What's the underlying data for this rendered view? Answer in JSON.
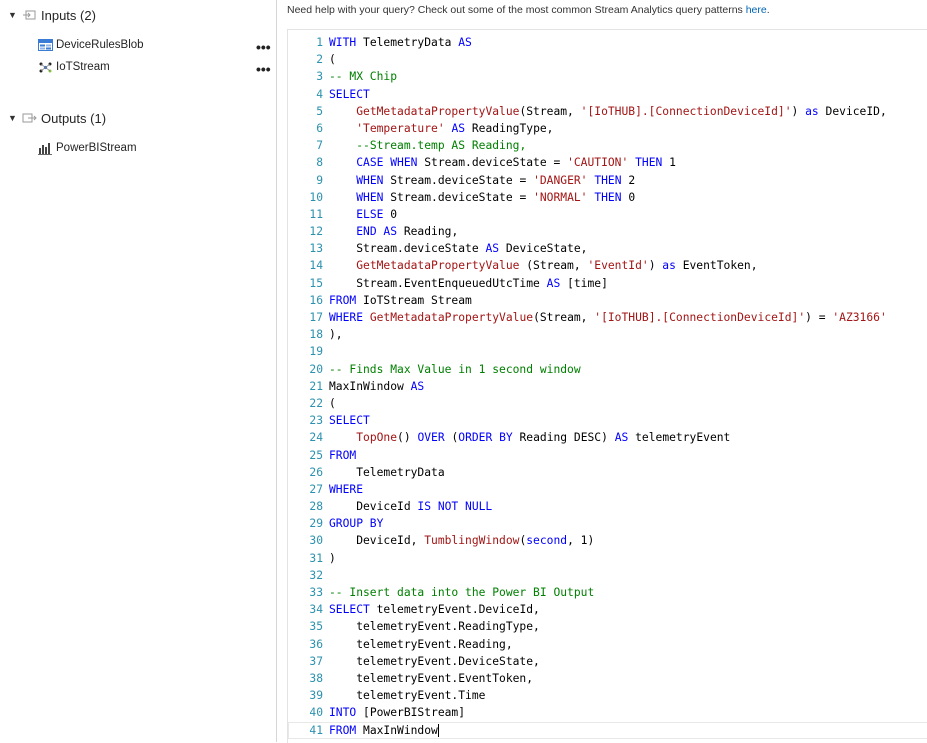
{
  "sidebar": {
    "inputs_label": "Inputs (2)",
    "inputs_items": [
      {
        "label": "DeviceRulesBlob",
        "icon": "blob-storage-icon"
      },
      {
        "label": "IoTStream",
        "icon": "iot-hub-icon"
      }
    ],
    "outputs_label": "Outputs (1)",
    "outputs_items": [
      {
        "label": "PowerBIStream",
        "icon": "power-bi-icon"
      }
    ],
    "more_label": "•••"
  },
  "help": {
    "text": "Need help with your query? Check out some of the most common Stream Analytics query patterns ",
    "link": "here",
    "suffix": "."
  },
  "colors": {
    "keyword": "#0000ff",
    "string": "#a31515",
    "comment": "#008000",
    "line_number": "#2b91af",
    "link": "#0064b4"
  },
  "editor": {
    "lines": [
      [
        [
          "kw",
          "WITH"
        ],
        [
          "pl",
          " TelemetryData "
        ],
        [
          "kw",
          "AS"
        ]
      ],
      [
        [
          "pl",
          "("
        ]
      ],
      [
        [
          "cm",
          "-- MX Chip"
        ]
      ],
      [
        [
          "kw",
          "SELECT"
        ]
      ],
      [
        [
          "pl",
          "    "
        ],
        [
          "fn",
          "GetMetadataPropertyValue"
        ],
        [
          "pl",
          "(Stream, "
        ],
        [
          "st",
          "'[IoTHUB].[ConnectionDeviceId]'"
        ],
        [
          "pl",
          ") "
        ],
        [
          "kw",
          "as"
        ],
        [
          "pl",
          " DeviceID,"
        ]
      ],
      [
        [
          "pl",
          "    "
        ],
        [
          "st",
          "'Temperature'"
        ],
        [
          "pl",
          " "
        ],
        [
          "kw",
          "AS"
        ],
        [
          "pl",
          " ReadingType,"
        ]
      ],
      [
        [
          "pl",
          "    "
        ],
        [
          "cm",
          "--Stream.temp AS Reading,"
        ]
      ],
      [
        [
          "pl",
          "    "
        ],
        [
          "kw",
          "CASE WHEN"
        ],
        [
          "pl",
          " Stream.deviceState = "
        ],
        [
          "st",
          "'CAUTION'"
        ],
        [
          "pl",
          " "
        ],
        [
          "kw",
          "THEN"
        ],
        [
          "pl",
          " 1"
        ]
      ],
      [
        [
          "pl",
          "    "
        ],
        [
          "kw",
          "WHEN"
        ],
        [
          "pl",
          " Stream.deviceState = "
        ],
        [
          "st",
          "'DANGER'"
        ],
        [
          "pl",
          " "
        ],
        [
          "kw",
          "THEN"
        ],
        [
          "pl",
          " 2"
        ]
      ],
      [
        [
          "pl",
          "    "
        ],
        [
          "kw",
          "WHEN"
        ],
        [
          "pl",
          " Stream.deviceState = "
        ],
        [
          "st",
          "'NORMAL'"
        ],
        [
          "pl",
          " "
        ],
        [
          "kw",
          "THEN"
        ],
        [
          "pl",
          " 0"
        ]
      ],
      [
        [
          "pl",
          "    "
        ],
        [
          "kw",
          "ELSE"
        ],
        [
          "pl",
          " 0"
        ]
      ],
      [
        [
          "pl",
          "    "
        ],
        [
          "kw",
          "END AS"
        ],
        [
          "pl",
          " Reading,"
        ]
      ],
      [
        [
          "pl",
          "    Stream.deviceState "
        ],
        [
          "kw",
          "AS"
        ],
        [
          "pl",
          " DeviceState,"
        ]
      ],
      [
        [
          "pl",
          "    "
        ],
        [
          "fn",
          "GetMetadataPropertyValue"
        ],
        [
          "pl",
          " (Stream, "
        ],
        [
          "st",
          "'EventId'"
        ],
        [
          "pl",
          ") "
        ],
        [
          "kw",
          "as"
        ],
        [
          "pl",
          " EventToken,"
        ]
      ],
      [
        [
          "pl",
          "    Stream.EventEnqueuedUtcTime "
        ],
        [
          "kw",
          "AS"
        ],
        [
          "pl",
          " [time]"
        ]
      ],
      [
        [
          "kw",
          "FROM"
        ],
        [
          "pl",
          " IoTStream Stream"
        ]
      ],
      [
        [
          "kw",
          "WHERE"
        ],
        [
          "pl",
          " "
        ],
        [
          "fn",
          "GetMetadataPropertyValue"
        ],
        [
          "pl",
          "(Stream, "
        ],
        [
          "st",
          "'[IoTHUB].[ConnectionDeviceId]'"
        ],
        [
          "pl",
          ") = "
        ],
        [
          "st",
          "'AZ3166'"
        ]
      ],
      [
        [
          "pl",
          "),"
        ]
      ],
      [
        [
          "pl",
          ""
        ]
      ],
      [
        [
          "cm",
          "-- Finds Max Value in 1 second window"
        ]
      ],
      [
        [
          "pl",
          "MaxInWindow "
        ],
        [
          "kw",
          "AS"
        ]
      ],
      [
        [
          "pl",
          "("
        ]
      ],
      [
        [
          "kw",
          "SELECT"
        ]
      ],
      [
        [
          "pl",
          "    "
        ],
        [
          "fn",
          "TopOne"
        ],
        [
          "pl",
          "() "
        ],
        [
          "kw",
          "OVER"
        ],
        [
          "pl",
          " ("
        ],
        [
          "kw",
          "ORDER BY"
        ],
        [
          "pl",
          " Reading DESC) "
        ],
        [
          "kw",
          "AS"
        ],
        [
          "pl",
          " telemetryEvent"
        ]
      ],
      [
        [
          "kw",
          "FROM"
        ]
      ],
      [
        [
          "pl",
          "    TelemetryData"
        ]
      ],
      [
        [
          "kw",
          "WHERE"
        ]
      ],
      [
        [
          "pl",
          "    DeviceId "
        ],
        [
          "kw",
          "IS NOT NULL"
        ]
      ],
      [
        [
          "kw",
          "GROUP BY"
        ]
      ],
      [
        [
          "pl",
          "    DeviceId, "
        ],
        [
          "fn",
          "TumblingWindow"
        ],
        [
          "pl",
          "("
        ],
        [
          "kw",
          "second"
        ],
        [
          "pl",
          ", 1)"
        ]
      ],
      [
        [
          "pl",
          ")"
        ]
      ],
      [
        [
          "pl",
          ""
        ]
      ],
      [
        [
          "cm",
          "-- Insert data into the Power BI Output"
        ]
      ],
      [
        [
          "kw",
          "SELECT"
        ],
        [
          "pl",
          " telemetryEvent.DeviceId,"
        ]
      ],
      [
        [
          "pl",
          "    telemetryEvent.ReadingType,"
        ]
      ],
      [
        [
          "pl",
          "    telemetryEvent.Reading,"
        ]
      ],
      [
        [
          "pl",
          "    telemetryEvent.DeviceState,"
        ]
      ],
      [
        [
          "pl",
          "    telemetryEvent.EventToken,"
        ]
      ],
      [
        [
          "pl",
          "    telemetryEvent.Time"
        ]
      ],
      [
        [
          "kw",
          "INTO"
        ],
        [
          "pl",
          " [PowerBIStream]"
        ]
      ],
      [
        [
          "kw",
          "FROM"
        ],
        [
          "pl",
          " MaxInWindow"
        ]
      ]
    ]
  }
}
